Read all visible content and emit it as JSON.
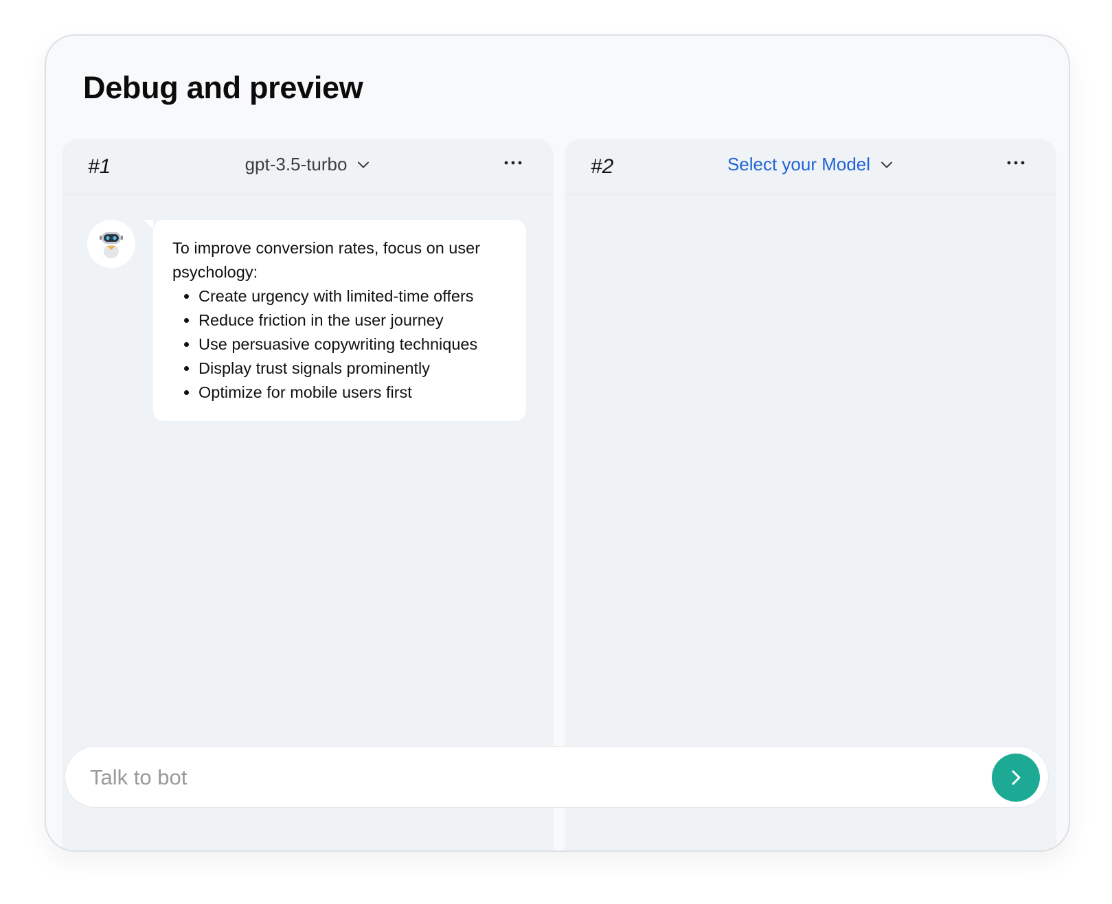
{
  "page": {
    "title": "Debug and preview"
  },
  "panels": [
    {
      "index": "#1",
      "model": "gpt-3.5-turbo",
      "messages": [
        {
          "role": "bot",
          "intro": "To improve conversion rates, focus on user psychology:",
          "bullets": [
            "Create urgency with limited-time offers",
            "Reduce friction in the user journey",
            "Use persuasive copywriting techniques",
            "Display trust signals prominently",
            "Optimize for mobile users first"
          ]
        }
      ]
    },
    {
      "index": "#2",
      "model": "Select your Model",
      "messages": []
    }
  ],
  "input": {
    "placeholder": "Talk to bot",
    "value": ""
  },
  "icons": {
    "avatar": "robot-icon",
    "dropdown": "chevron-down-icon",
    "more": "more-horizontal-icon",
    "send": "chevron-right-icon"
  },
  "colors": {
    "accent_send": "#1daa94",
    "model_placeholder": "#1f63d6",
    "panel_bg": "#f0f3f6",
    "card_bg": "#f8f9fb"
  }
}
